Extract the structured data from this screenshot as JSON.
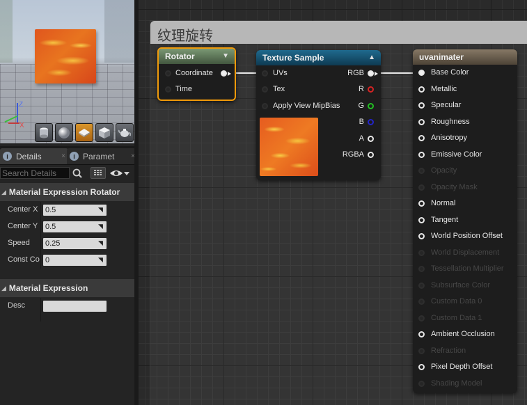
{
  "left_panel": {
    "viewport": {
      "axis_labels": {
        "z": "Z",
        "x": "X"
      },
      "toolbar": [
        {
          "icon": "cylinder-icon",
          "active": false
        },
        {
          "icon": "sphere-icon",
          "active": false
        },
        {
          "icon": "plane-icon",
          "active": true
        },
        {
          "icon": "cube-icon",
          "active": false
        },
        {
          "icon": "teapot-icon",
          "active": false
        }
      ]
    },
    "tabs": [
      {
        "label": "Details",
        "close": "×"
      },
      {
        "label": "Paramet",
        "close": "×"
      }
    ],
    "search": {
      "placeholder": "Search Details"
    },
    "sections": {
      "rotator": {
        "title": "Material Expression Rotator",
        "props": [
          {
            "label": "Center X",
            "value": "0.5"
          },
          {
            "label": "Center Y",
            "value": "0.5"
          },
          {
            "label": "Speed",
            "value": "0.25"
          },
          {
            "label": "Const Coordinate",
            "value": "0"
          }
        ]
      },
      "expression": {
        "title": "Material Expression",
        "props": [
          {
            "label": "Desc",
            "value": ""
          }
        ]
      }
    }
  },
  "graph": {
    "comment_title": "纹理旋转",
    "nodes": {
      "rotator": {
        "title": "Rotator",
        "inputs": [
          "Coordinate",
          "Time"
        ]
      },
      "texture_sample": {
        "title": "Texture Sample",
        "inputs": [
          "UVs",
          "Tex",
          "Apply View MipBias"
        ],
        "outputs": [
          "RGB",
          "R",
          "G",
          "B",
          "A",
          "RGBA"
        ]
      },
      "material": {
        "title": "uvanimater",
        "inputs": [
          {
            "label": "Base Color",
            "enabled": true
          },
          {
            "label": "Metallic",
            "enabled": true
          },
          {
            "label": "Specular",
            "enabled": true
          },
          {
            "label": "Roughness",
            "enabled": true
          },
          {
            "label": "Anisotropy",
            "enabled": true
          },
          {
            "label": "Emissive Color",
            "enabled": true
          },
          {
            "label": "Opacity",
            "enabled": false
          },
          {
            "label": "Opacity Mask",
            "enabled": false
          },
          {
            "label": "Normal",
            "enabled": true
          },
          {
            "label": "Tangent",
            "enabled": true
          },
          {
            "label": "World Position Offset",
            "enabled": true
          },
          {
            "label": "World Displacement",
            "enabled": false
          },
          {
            "label": "Tessellation Multiplier",
            "enabled": false
          },
          {
            "label": "Subsurface Color",
            "enabled": false
          },
          {
            "label": "Custom Data 0",
            "enabled": false
          },
          {
            "label": "Custom Data 1",
            "enabled": false
          },
          {
            "label": "Ambient Occlusion",
            "enabled": true
          },
          {
            "label": "Refraction",
            "enabled": false
          },
          {
            "label": "Pixel Depth Offset",
            "enabled": true
          },
          {
            "label": "Shading Model",
            "enabled": false
          }
        ]
      }
    },
    "pin_colors": {
      "R": "#d62424",
      "G": "#22c022",
      "B": "#2424c8",
      "default": "#e8e8e8"
    },
    "selection_color": "#f09a0a"
  }
}
